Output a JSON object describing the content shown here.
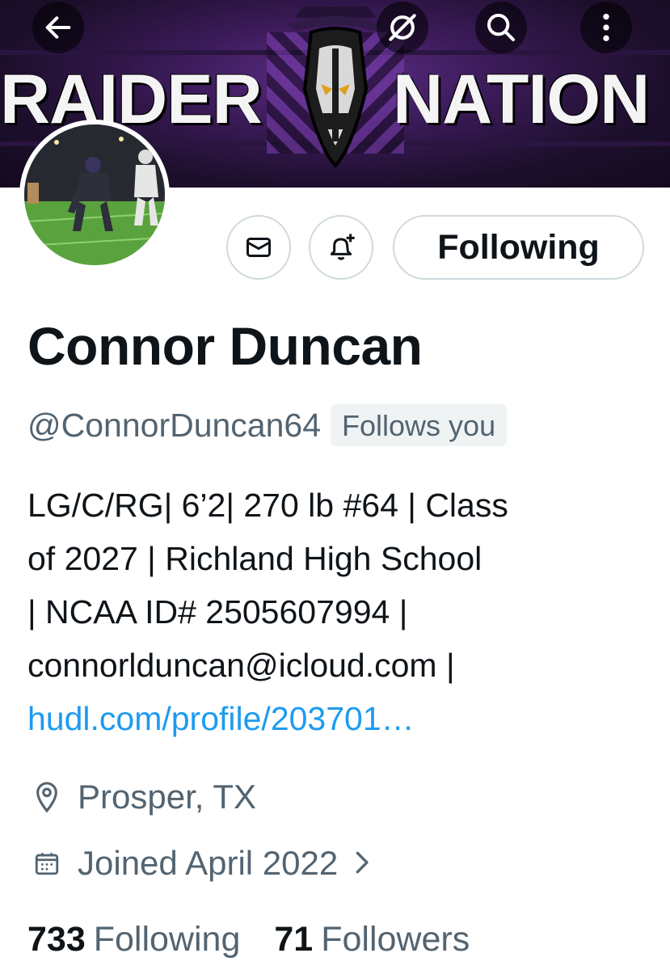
{
  "banner": {
    "word_left": "RAIDER",
    "word_right": "NATION"
  },
  "toolbar": {
    "back_icon": "arrow-left-icon",
    "view_icon": "eye-slash-icon",
    "search_icon": "search-icon",
    "more_icon": "more-vertical-icon"
  },
  "actions": {
    "message_icon": "mail-icon",
    "notify_icon": "bell-plus-icon",
    "follow_label": "Following"
  },
  "profile": {
    "name": "Connor Duncan",
    "handle": "@ConnorDuncan64",
    "follows_you": "Follows you",
    "bio_lines": [
      "LG/C/RG| 6’2| 270 lb #64 | Class",
      "of 2027 | Richland High School",
      "| NCAA ID# 2505607994 |",
      "connorlduncan@icloud.com |"
    ],
    "bio_link": "hudl.com/profile/203701…",
    "location": "Prosper, TX",
    "joined": "Joined April 2022"
  },
  "stats": {
    "following_count": "733",
    "following_label": "Following",
    "followers_count": "71",
    "followers_label": "Followers"
  },
  "colors": {
    "link": "#1d9bf0",
    "muted": "#536471",
    "text": "#0f1419",
    "border": "#cfd9de"
  }
}
